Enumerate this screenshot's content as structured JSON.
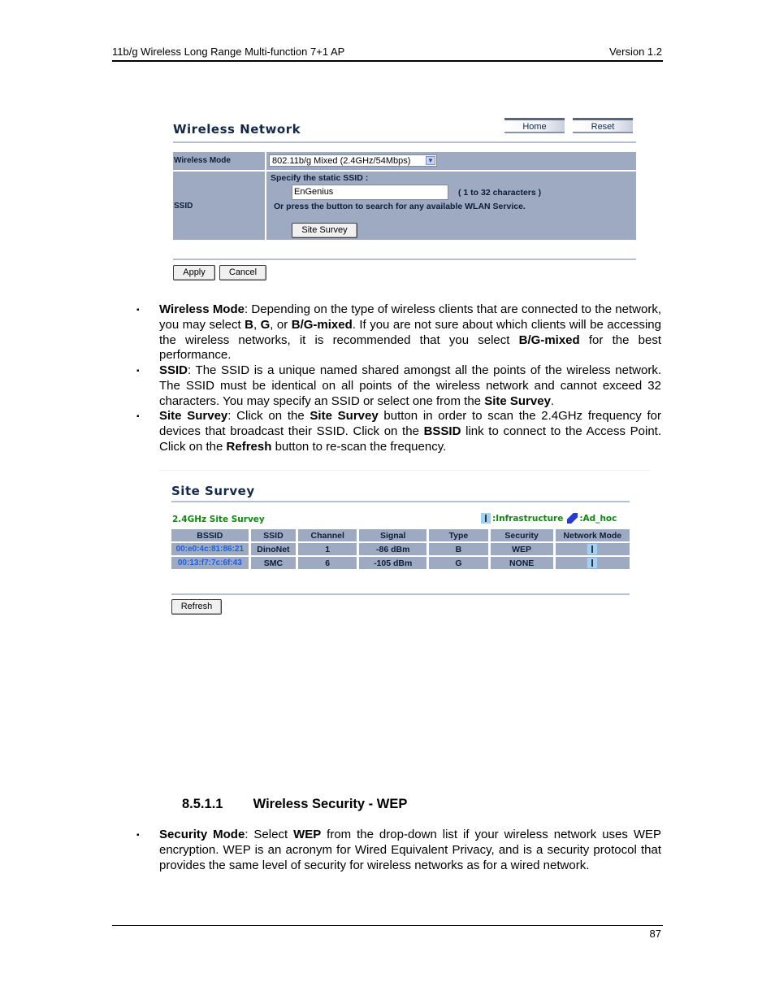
{
  "header": {
    "title": "11b/g Wireless Long Range Multi-function 7+1 AP",
    "version": "Version 1.2"
  },
  "wireless_network": {
    "title": "Wireless Network",
    "home_label": "Home",
    "reset_label": "Reset",
    "wireless_mode_label": "Wireless Mode",
    "wireless_mode_value": "802.11b/g Mixed (2.4GHz/54Mbps)",
    "ssid_label": "SSID",
    "specify_text": "Specify the static SSID  :",
    "ssid_value": "EnGenius",
    "ssid_hint": "( 1 to 32 characters )",
    "search_text": "Or press the button to search for any available WLAN Service.",
    "site_survey_button": "Site Survey",
    "apply_label": "Apply",
    "cancel_label": "Cancel"
  },
  "bullets": [
    {
      "term": "Wireless Mode",
      "parts": [
        ": Depending on the type of wireless clients that are connected to the network, you may select ",
        "B",
        ", ",
        "G",
        ", or ",
        "B/G-mixed",
        ". If you are not sure about which clients will be accessing the wireless networks, it is recommended that you select ",
        "B/G-mixed",
        " for the best performance."
      ]
    },
    {
      "term": "SSID",
      "parts": [
        ": The SSID is a unique named shared amongst all the points of the wireless network. The SSID must be identical on all points of the wireless network and cannot exceed 32 characters. You may specify an SSID or select one from the ",
        "Site Survey",
        "."
      ]
    },
    {
      "term": "Site Survey",
      "parts": [
        ": Click on the ",
        "Site Survey",
        " button in order to scan the 2.4GHz frequency for devices that broadcast their SSID. Click on the ",
        "BSSID",
        " link to connect to the Access Point. Click on the ",
        "Refresh",
        " button to re-scan the frequency."
      ]
    }
  ],
  "site_survey": {
    "title": "Site Survey",
    "subtitle": "2.4GHz Site Survey",
    "legend_infrastructure": ":Infrastructure",
    "legend_adhoc": ":Ad_hoc",
    "columns": [
      "BSSID",
      "SSID",
      "Channel",
      "Signal",
      "Type",
      "Security",
      "Network Mode"
    ],
    "rows": [
      {
        "bssid": "00:e0:4c:81:86:21",
        "ssid": "DinoNet",
        "channel": "1",
        "signal": "-86 dBm",
        "type": "B",
        "security": "WEP",
        "mode_icon": "infrastructure-icon"
      },
      {
        "bssid": "00:13:f7:7c:6f:43",
        "ssid": "SMC",
        "channel": "6",
        "signal": "-105 dBm",
        "type": "G",
        "security": "NONE",
        "mode_icon": "infrastructure-icon"
      }
    ],
    "refresh_label": "Refresh"
  },
  "section": {
    "number": "8.5.1.1",
    "title": "Wireless Security - WEP"
  },
  "security_bullet": {
    "term": "Security Mode",
    "parts": [
      ": Select ",
      "WEP",
      " from the drop-down list if your wireless network uses WEP encryption. WEP is an acronym for Wired Equivalent Privacy, and is a security protocol that provides the same level of security for wireless networks as for a wired network."
    ]
  },
  "footer": {
    "page_number": "87"
  }
}
